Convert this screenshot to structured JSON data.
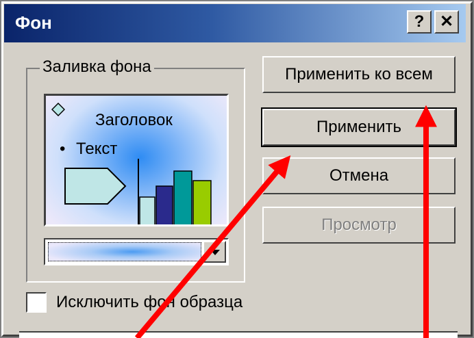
{
  "window": {
    "title": "Фон",
    "help_label": "?",
    "close_label": "✕"
  },
  "fill_group": {
    "label": "Заливка фона",
    "preview": {
      "title": "Заголовок",
      "bullet": "•",
      "text": "Текст"
    }
  },
  "buttons": {
    "apply_all": "Применить ко всем",
    "apply": "Применить",
    "cancel": "Отмена",
    "preview": "Просмотр"
  },
  "omit_master": {
    "label": "Исключить фон образца",
    "checked": false
  },
  "colors": {
    "titlebar_start": "#0a246a",
    "titlebar_end": "#a6caf0",
    "dialog_face": "#d4d0c8",
    "annotation_arrow": "#ff0000"
  }
}
